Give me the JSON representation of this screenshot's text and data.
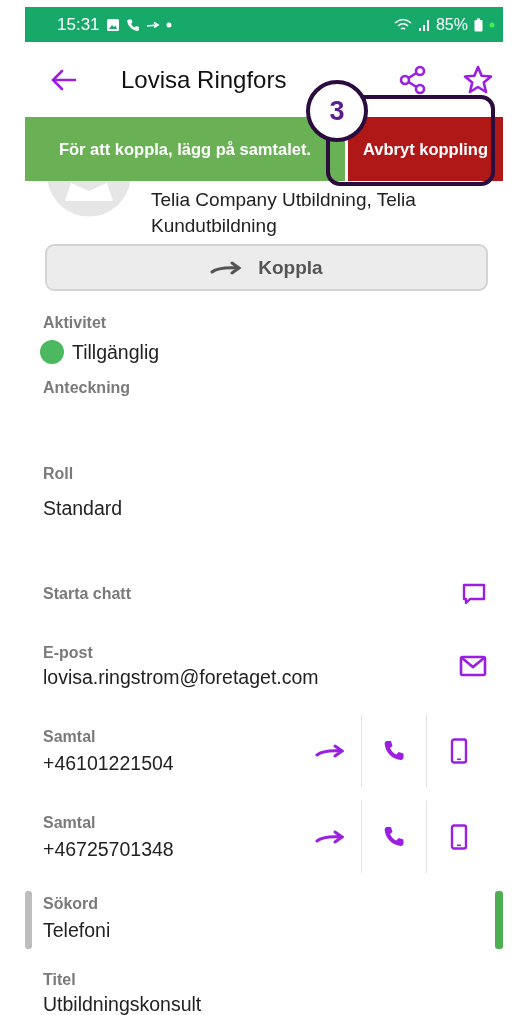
{
  "status_bar": {
    "time": "15:31",
    "battery": "85%"
  },
  "app_bar": {
    "title": "Lovisa Ringfors"
  },
  "banner": {
    "message": "För att koppla, lägg på samtalet.",
    "cancel_button": "Avbryt koppling"
  },
  "callout": {
    "number": "3"
  },
  "contact": {
    "organization": "Telia Company Utbildning, Telia Kundutbildning"
  },
  "transfer_button": {
    "label": "Koppla"
  },
  "fields": [
    {
      "kind": "presence",
      "label": "Aktivitet",
      "value": "Tillgänglig",
      "color": "#4cb860"
    },
    {
      "kind": "note",
      "label": "Anteckning"
    },
    {
      "kind": "text",
      "label": "Roll",
      "value": "Standard"
    },
    {
      "kind": "chat",
      "label": "Starta chatt"
    },
    {
      "kind": "email",
      "label": "E-post",
      "value": "lovisa.ringstrom@foretaget.com"
    },
    {
      "kind": "phone",
      "label": "Samtal",
      "value": "+46101221504"
    },
    {
      "kind": "phone",
      "label": "Samtal",
      "value": "+46725701348"
    },
    {
      "kind": "keyword",
      "label": "Sökord",
      "value": "Telefoni"
    },
    {
      "kind": "text",
      "label": "Titel",
      "value": "Utbildningskonsult"
    }
  ]
}
